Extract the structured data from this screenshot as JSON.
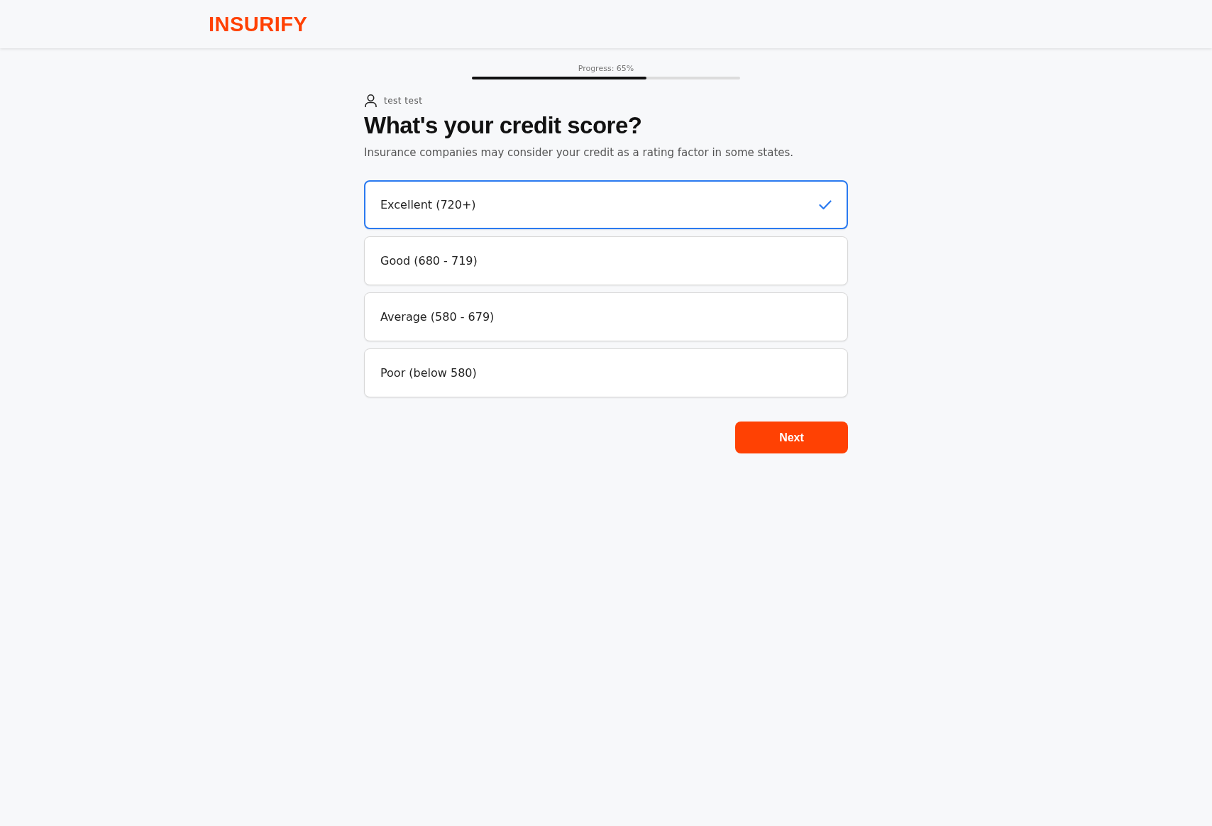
{
  "header": {
    "logo": "INSURIFY"
  },
  "progress": {
    "label": "Progress: 65%",
    "level": 0.65
  },
  "user": {
    "name": "test test"
  },
  "question": {
    "title": "What's your credit score?",
    "subtitle": "Insurance companies may consider your credit as a rating factor in some states."
  },
  "options": [
    {
      "label": "Excellent (720+)",
      "selected": true
    },
    {
      "label": "Good (680 - 719)",
      "selected": false
    },
    {
      "label": "Average (580 - 679)",
      "selected": false
    },
    {
      "label": "Poor (below 580)",
      "selected": false
    }
  ],
  "buttons": [
    "Next"
  ]
}
